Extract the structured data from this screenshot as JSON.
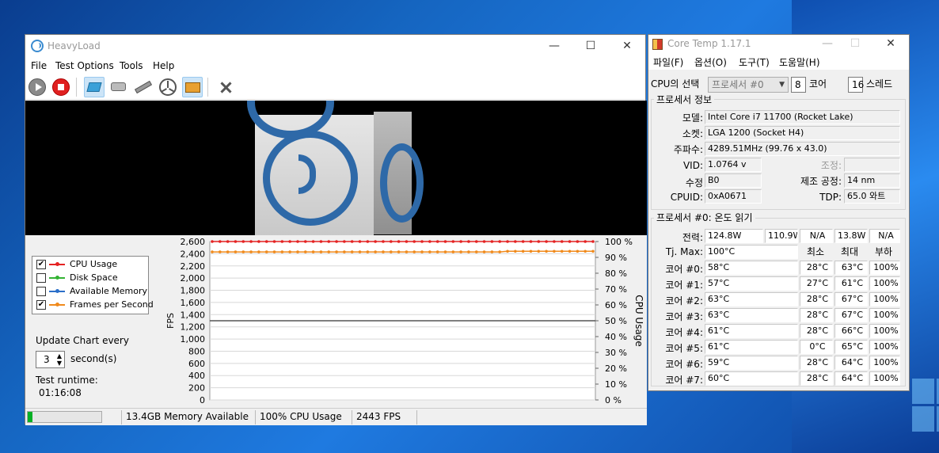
{
  "heavyload": {
    "title": "HeavyLoad",
    "menu": [
      "File",
      "Test Options",
      "Tools",
      "Help"
    ],
    "legend": [
      {
        "label": "CPU Usage",
        "checked": true,
        "color": "#e52222"
      },
      {
        "label": "Disk Space",
        "checked": false,
        "color": "#33b333"
      },
      {
        "label": "Available Memory",
        "checked": false,
        "color": "#2b6fc9"
      },
      {
        "label": "Frames per Second",
        "checked": true,
        "color": "#f08a1c"
      }
    ],
    "update_label": "Update Chart every",
    "update_value": "3",
    "update_unit": "second(s)",
    "runtime_label": "Test runtime:",
    "runtime_value": "01:16:08",
    "status": {
      "progress": 0.06,
      "memory": "13.4GB Memory Available",
      "cpu": "100% CPU Usage",
      "fps": "2443 FPS"
    }
  },
  "chart_data": {
    "type": "line",
    "ylabel": "FPS",
    "y2label": "CPU Usage",
    "ylim": [
      0,
      2600
    ],
    "y2lim": [
      0,
      100
    ],
    "yticks": [
      "0",
      "200",
      "400",
      "600",
      "800",
      "1,000",
      "1,200",
      "1,400",
      "1,600",
      "1,800",
      "2,000",
      "2,200",
      "2,400",
      "2,600"
    ],
    "y2ticks": [
      "0 %",
      "10 %",
      "20 %",
      "30 %",
      "40 %",
      "50 %",
      "60 %",
      "70 %",
      "80 %",
      "90 %",
      "100 %"
    ],
    "series": [
      {
        "name": "CPU Usage",
        "axis": "right",
        "color": "#e52222",
        "values": [
          100,
          100,
          100,
          100,
          100,
          100,
          100,
          100,
          100,
          100,
          100,
          100,
          100,
          100,
          100,
          100,
          100,
          100,
          100,
          100,
          100,
          100,
          100,
          100,
          100,
          100,
          100,
          100,
          100,
          100,
          100,
          100,
          100,
          100,
          100,
          100,
          100,
          100,
          100,
          100,
          100,
          100,
          100,
          100,
          100,
          100,
          100,
          100,
          100,
          100
        ]
      },
      {
        "name": "Frames per Second",
        "axis": "left",
        "color": "#f08a1c",
        "values": [
          2430,
          2430,
          2430,
          2430,
          2430,
          2430,
          2430,
          2430,
          2430,
          2430,
          2430,
          2430,
          2430,
          2430,
          2430,
          2430,
          2430,
          2430,
          2430,
          2430,
          2430,
          2430,
          2430,
          2430,
          2430,
          2430,
          2430,
          2430,
          2430,
          2430,
          2430,
          2430,
          2430,
          2430,
          2430,
          2430,
          2430,
          2430,
          2440,
          2440,
          2440,
          2440,
          2440,
          2440,
          2440,
          2440,
          2440,
          2440,
          2440,
          2440
        ]
      }
    ],
    "reference_line": 1300
  },
  "coretemp": {
    "title": "Core Temp 1.17.1",
    "menu": [
      "파일(F)",
      "옵션(O)",
      "도구(T)",
      "도움말(H)"
    ],
    "cpu_select_label": "CPU의 선택",
    "cpu_select_value": "프로세서 #0",
    "cores_value": "8",
    "cores_label": "코어",
    "threads_value": "16",
    "threads_label": "스레드",
    "proc_info_title": "프로세서 정보",
    "model_label": "모델:",
    "model": "Intel Core i7 11700 (Rocket Lake)",
    "socket_label": "소켓:",
    "socket": "LGA 1200 (Socket H4)",
    "freq_label": "주파수:",
    "freq": "4289.51MHz (99.76 x 43.0)",
    "vid_label": "VID:",
    "vid": "1.0764 v",
    "adjust_label": "조정:",
    "adjust": "",
    "rev_label": "수정",
    "rev": "B0",
    "lith_label": "제조 공정:",
    "lith": "14 nm",
    "cpuid_label": "CPUID:",
    "cpuid": "0xA0671",
    "tdp_label": "TDP:",
    "tdp": "65.0 와트",
    "temp_title": "프로세서 #0: 온도 읽기",
    "power_label": "전력:",
    "power": [
      "124.8W",
      "110.9W",
      "N/A",
      "13.8W",
      "N/A"
    ],
    "tjmax_label": "Tj. Max:",
    "tjmax": "100°C",
    "col_min": "최소",
    "col_max": "최대",
    "col_load": "부하",
    "cores": [
      {
        "label": "코어 #0:",
        "temp": "58°C",
        "min": "28°C",
        "max": "63°C",
        "load": "100%"
      },
      {
        "label": "코어 #1:",
        "temp": "57°C",
        "min": "27°C",
        "max": "61°C",
        "load": "100%"
      },
      {
        "label": "코어 #2:",
        "temp": "63°C",
        "min": "28°C",
        "max": "67°C",
        "load": "100%"
      },
      {
        "label": "코어 #3:",
        "temp": "63°C",
        "min": "28°C",
        "max": "67°C",
        "load": "100%"
      },
      {
        "label": "코어 #4:",
        "temp": "61°C",
        "min": "28°C",
        "max": "66°C",
        "load": "100%"
      },
      {
        "label": "코어 #5:",
        "temp": "61°C",
        "min": "0°C",
        "max": "65°C",
        "load": "100%"
      },
      {
        "label": "코어 #6:",
        "temp": "59°C",
        "min": "28°C",
        "max": "64°C",
        "load": "100%"
      },
      {
        "label": "코어 #7:",
        "temp": "60°C",
        "min": "28°C",
        "max": "64°C",
        "load": "100%"
      }
    ]
  }
}
